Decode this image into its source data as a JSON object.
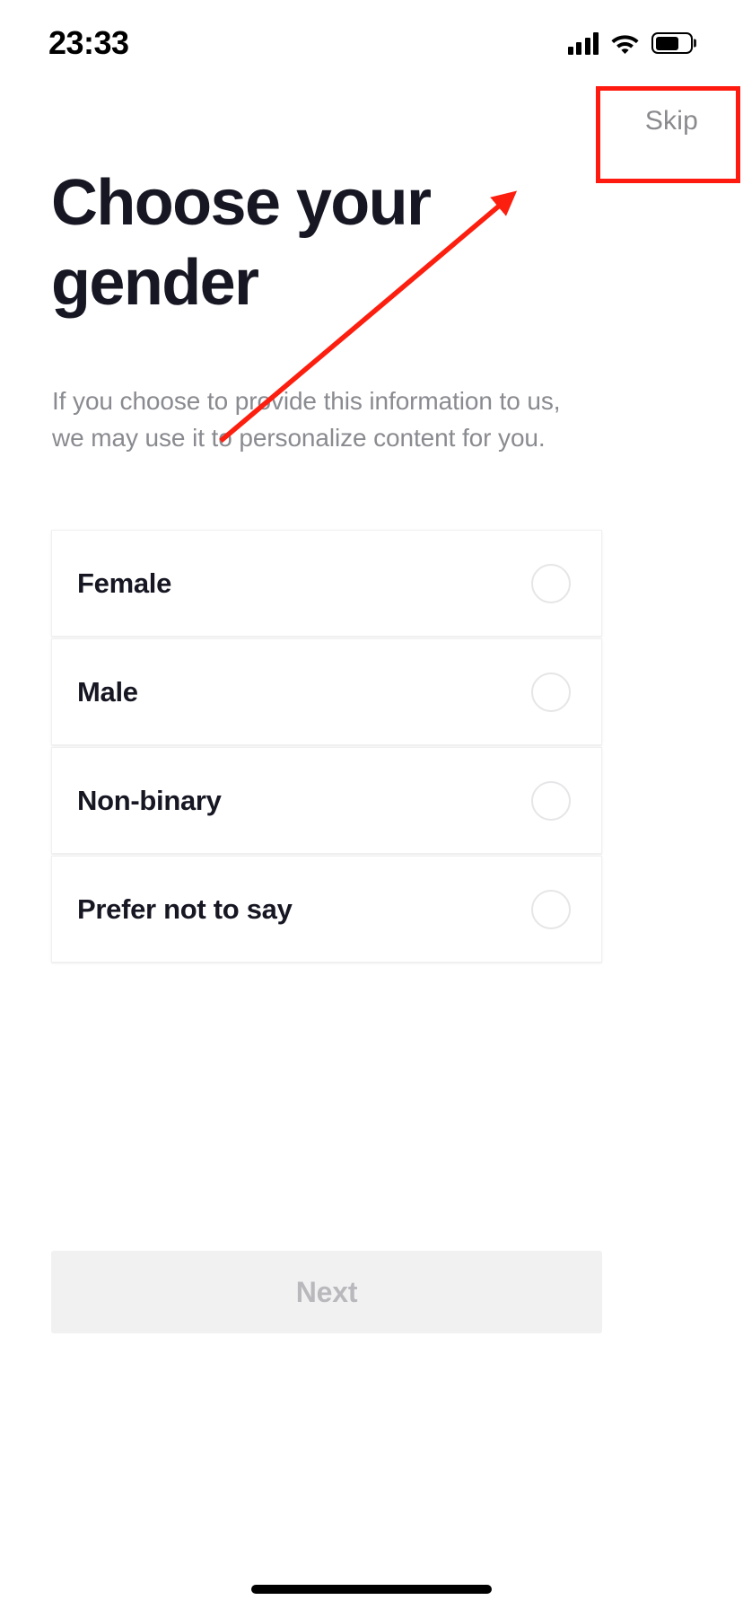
{
  "status_bar": {
    "time": "23:33",
    "signal_icon": "cellular-signal-icon",
    "signal_bars": 4,
    "wifi_icon": "wifi-icon",
    "battery_icon": "battery-icon",
    "battery_level_pct": 70
  },
  "header": {
    "skip_label": "Skip"
  },
  "main": {
    "title": "Choose your gender",
    "subtitle": "If you choose to provide this information to us, we may use it to personalize content for you.",
    "options": [
      {
        "label": "Female",
        "selected": false
      },
      {
        "label": "Male",
        "selected": false
      },
      {
        "label": "Non-binary",
        "selected": false
      },
      {
        "label": "Prefer not to say",
        "selected": false
      }
    ]
  },
  "footer": {
    "next_label": "Next",
    "next_enabled": false
  },
  "annotation": {
    "highlight_target": "skip-button",
    "box_color": "#ff1a10",
    "arrow_color": "#fc1f0f"
  },
  "colors": {
    "text_primary": "#161722",
    "text_secondary": "#8a8b90",
    "card_bg": "#ffffff",
    "card_border": "#f0f0f1",
    "radio_border": "#e6e6e8",
    "button_disabled_bg": "#f1f1f2",
    "button_disabled_text": "#b9b9bd",
    "annotation_red": "#ff1a10"
  }
}
